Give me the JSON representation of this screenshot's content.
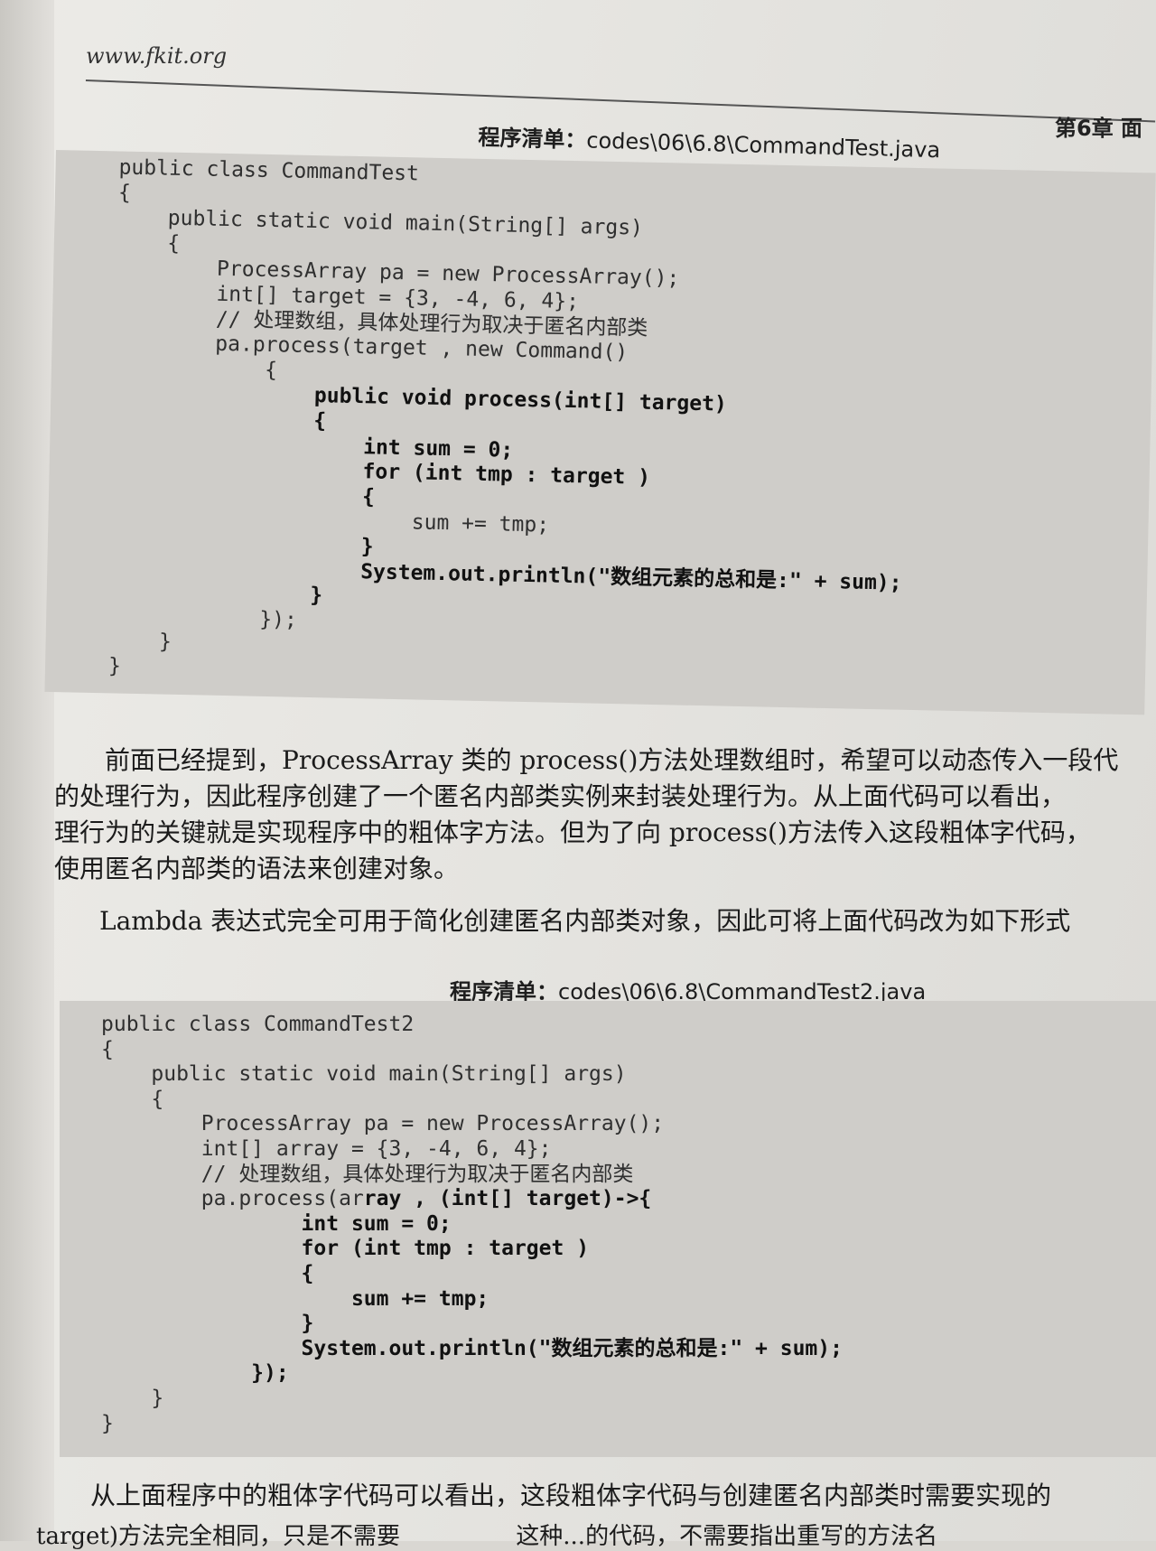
{
  "header": {
    "url": "www.fkit.org",
    "chapter": "第6章 面"
  },
  "listing1": {
    "label": "程序清单：",
    "path": "codes\\06\\6.8\\CommandTest.java",
    "lines": [
      {
        "text": "public class CommandTest",
        "bold": false
      },
      {
        "text": "{",
        "bold": false
      },
      {
        "text": "    public static void main(String[] args)",
        "bold": false
      },
      {
        "text": "    {",
        "bold": false
      },
      {
        "text": "        ProcessArray pa = new ProcessArray();",
        "bold": false
      },
      {
        "text": "        int[] target = {3, -4, 6, 4};",
        "bold": false
      },
      {
        "text": "        // 处理数组，具体处理行为取决于匿名内部类",
        "bold": false
      },
      {
        "text": "        pa.process(target , new Command()",
        "bold": false
      },
      {
        "text": "            {",
        "bold": false
      },
      {
        "text": "                public void process(int[] target)",
        "bold": true
      },
      {
        "text": "                {",
        "bold": true
      },
      {
        "text": "                    int sum = 0;",
        "bold": true
      },
      {
        "text": "                    for (int tmp : target )",
        "bold": true
      },
      {
        "text": "                    {",
        "bold": true
      },
      {
        "text": "                        sum += tmp;",
        "bold": false
      },
      {
        "text": "                    }",
        "bold": true
      },
      {
        "text": "                    System.out.println(\"数组元素的总和是:\" + sum);",
        "bold": true
      },
      {
        "text": "                }",
        "bold": true
      },
      {
        "text": "            });",
        "bold": false
      },
      {
        "text": "    }",
        "bold": false
      },
      {
        "text": "}",
        "bold": false
      }
    ]
  },
  "paragraph1": [
    "前面已经提到，ProcessArray 类的 process()方法处理数组时，希望可以动态传入一段代",
    "的处理行为，因此程序创建了一个匿名内部类实例来封装处理行为。从上面代码可以看出，",
    "理行为的关键就是实现程序中的粗体字方法。但为了向 process()方法传入这段粗体字代码，",
    "使用匿名内部类的语法来创建对象。"
  ],
  "paragraph2": "Lambda 表达式完全可用于简化创建匿名内部类对象，因此可将上面代码改为如下形式",
  "listing2": {
    "label": "程序清单：",
    "path": "codes\\06\\6.8\\CommandTest2.java",
    "lines": [
      {
        "text": "public class CommandTest2",
        "bold": false
      },
      {
        "text": "{",
        "bold": false
      },
      {
        "text": "    public static void main(String[] args)",
        "bold": false
      },
      {
        "text": "    {",
        "bold": false
      },
      {
        "text": "        ProcessArray pa = new ProcessArray();",
        "bold": false
      },
      {
        "text": "        int[] array = {3, -4, 6, 4};",
        "bold": false
      },
      {
        "text": "        // 处理数组，具体处理行为取决于匿名内部类",
        "bold": false
      },
      {
        "text": "        pa.process(array , (int[] target)->{",
        "bold": false,
        "bold_from": 21
      },
      {
        "text": "                int sum = 0;",
        "bold": true
      },
      {
        "text": "                for (int tmp : target )",
        "bold": true
      },
      {
        "text": "                {",
        "bold": true
      },
      {
        "text": "                    sum += tmp;",
        "bold": true
      },
      {
        "text": "                }",
        "bold": true
      },
      {
        "text": "                System.out.println(\"数组元素的总和是:\" + sum);",
        "bold": true
      },
      {
        "text": "            });",
        "bold": true
      },
      {
        "text": "    }",
        "bold": false
      },
      {
        "text": "}",
        "bold": false
      }
    ]
  },
  "paragraph3": "从上面程序中的粗体字代码可以看出，这段粗体字代码与创建匿名内部类时需要实现的",
  "paragraph4_cut": "target)方法完全相同，只是不需要",
  "paragraph4_cut2": "这种...的代码，不需要指出重写的方法名"
}
